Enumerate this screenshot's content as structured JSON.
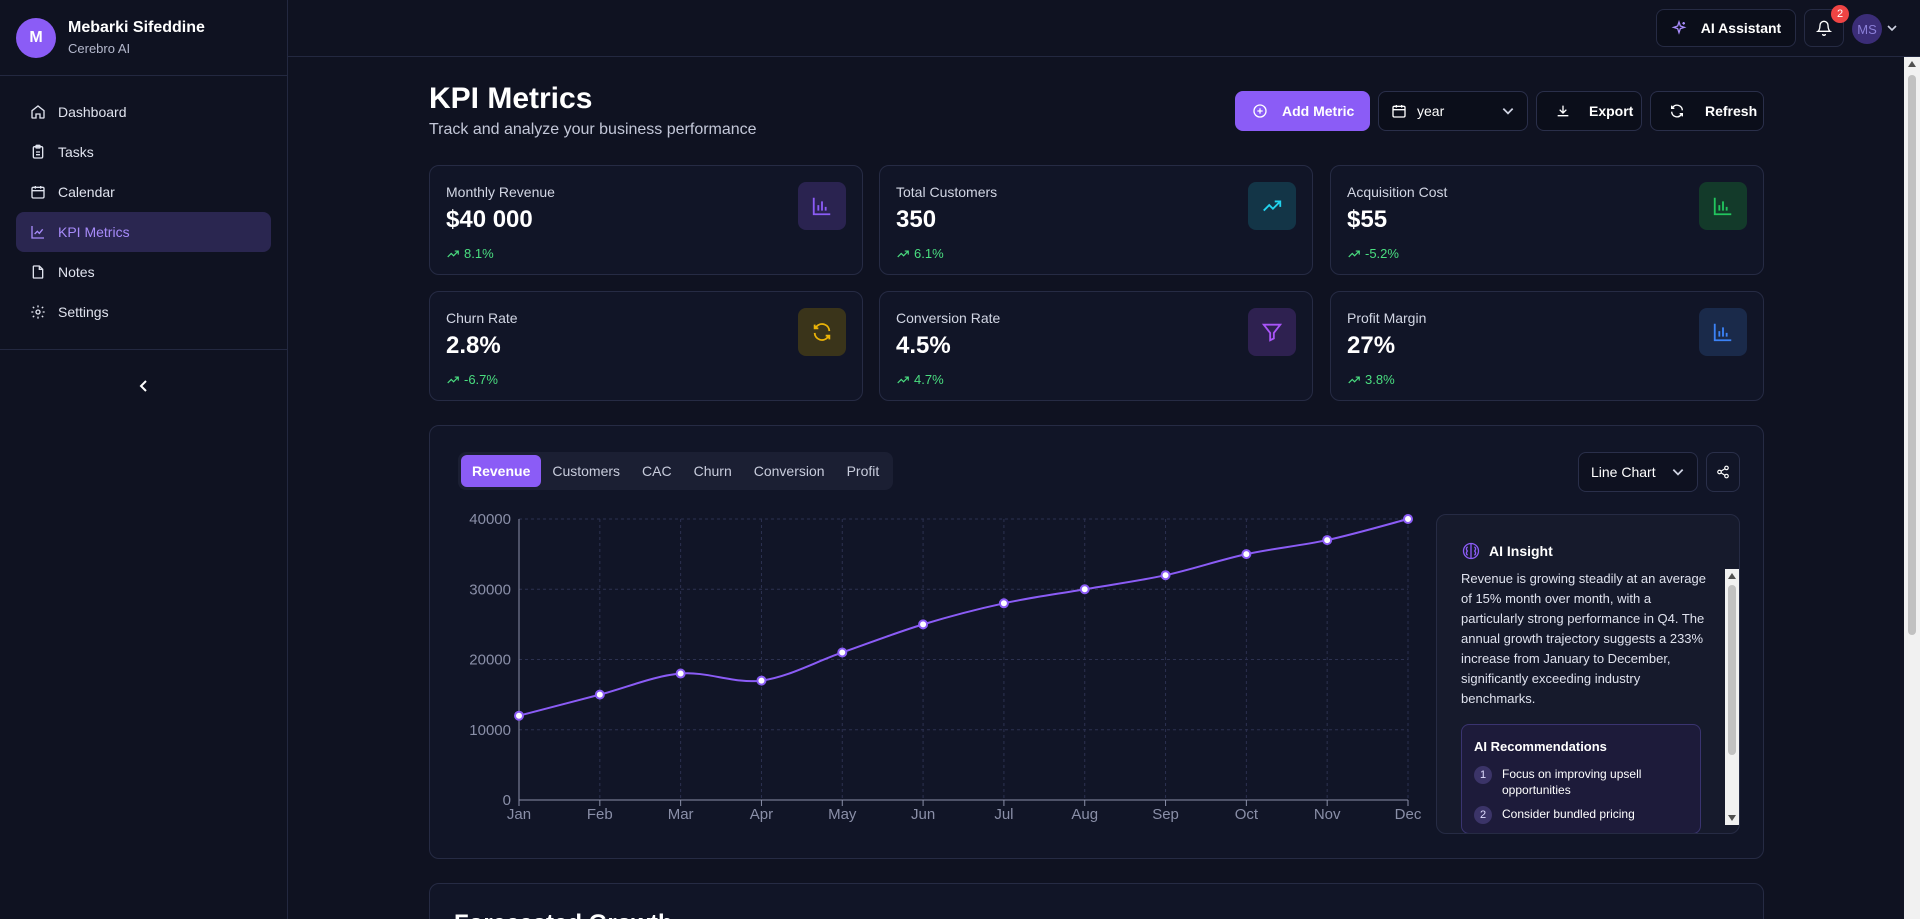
{
  "user": {
    "initial": "M",
    "name": "Mebarki Sifeddine",
    "org": "Cerebro AI",
    "avatar_initials": "MS"
  },
  "nav": [
    {
      "label": "Dashboard",
      "icon": "home-icon",
      "active": false
    },
    {
      "label": "Tasks",
      "icon": "clipboard-icon",
      "active": false
    },
    {
      "label": "Calendar",
      "icon": "calendar-icon",
      "active": false
    },
    {
      "label": "KPI Metrics",
      "icon": "line-chart-icon",
      "active": true
    },
    {
      "label": "Notes",
      "icon": "file-icon",
      "active": false
    },
    {
      "label": "Settings",
      "icon": "gear-icon",
      "active": false
    }
  ],
  "topbar": {
    "ai_assistant_label": "AI Assistant",
    "notification_count": "2"
  },
  "header": {
    "title": "KPI Metrics",
    "subtitle": "Track and analyze your business performance",
    "add_label": "Add Metric",
    "period_value": "year",
    "export_label": "Export",
    "refresh_label": "Refresh"
  },
  "kpis": [
    {
      "label": "Monthly Revenue",
      "value": "$40 000",
      "change": "8.1%",
      "icon": "bar-chart-icon",
      "color": "#8b5cf6",
      "bg": "#2a2350"
    },
    {
      "label": "Total Customers",
      "value": "350",
      "change": "6.1%",
      "icon": "trending-up-icon",
      "color": "#22d3ee",
      "bg": "#133547"
    },
    {
      "label": "Acquisition Cost",
      "value": "$55",
      "change": "-5.2%",
      "icon": "bar-chart-icon",
      "color": "#22c55e",
      "bg": "#133a2a"
    },
    {
      "label": "Churn Rate",
      "value": "2.8%",
      "change": "-6.7%",
      "icon": "refresh-icon",
      "color": "#eab308",
      "bg": "#3a341a"
    },
    {
      "label": "Conversion Rate",
      "value": "4.5%",
      "change": "4.7%",
      "icon": "filter-icon",
      "color": "#a855f7",
      "bg": "#2e2150"
    },
    {
      "label": "Profit Margin",
      "value": "27%",
      "change": "3.8%",
      "icon": "bar-chart-icon",
      "color": "#3b82f6",
      "bg": "#1a2a4a"
    }
  ],
  "tabs": [
    "Revenue",
    "Customers",
    "CAC",
    "Churn",
    "Conversion",
    "Profit"
  ],
  "active_tab": "Revenue",
  "chart_type_value": "Line Chart",
  "chart_data": {
    "type": "line",
    "categories": [
      "Jan",
      "Feb",
      "Mar",
      "Apr",
      "May",
      "Jun",
      "Jul",
      "Aug",
      "Sep",
      "Oct",
      "Nov",
      "Dec"
    ],
    "series": [
      {
        "values": [
          12000,
          15000,
          18000,
          17000,
          21000,
          25000,
          28000,
          30000,
          32000,
          35000,
          37000,
          40000
        ]
      }
    ],
    "ylim": [
      0,
      40000
    ],
    "yticks": [
      0,
      10000,
      20000,
      30000,
      40000
    ],
    "grid": true,
    "color": "#8b5cf6"
  },
  "insight": {
    "title": "AI Insight",
    "text": "Revenue is growing steadily at an average of 15% month over month, with a particularly strong performance in Q4. The annual growth trajectory suggests a 233% increase from January to December, significantly exceeding industry benchmarks.",
    "recs_title": "AI Recommendations",
    "recs": [
      "Focus on improving upsell opportunities",
      "Consider bundled pricing"
    ]
  },
  "forecast": {
    "title": "Forecasted Growth"
  }
}
